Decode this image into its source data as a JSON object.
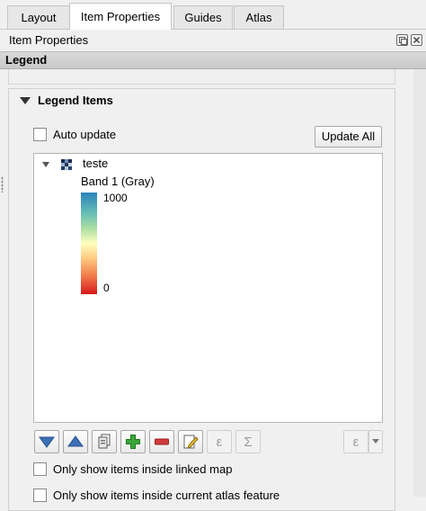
{
  "tabs": [
    {
      "label": "Layout",
      "active": false
    },
    {
      "label": "Item Properties",
      "active": true
    },
    {
      "label": "Guides",
      "active": false
    },
    {
      "label": "Atlas",
      "active": false
    }
  ],
  "panel": {
    "title": "Item Properties",
    "icons": [
      "float-panel-icon",
      "close-panel-icon"
    ]
  },
  "group_header": "Legend",
  "legend_items": {
    "title": "Legend Items",
    "auto_update_label": "Auto update",
    "auto_update_checked": false,
    "update_all_label": "Update All",
    "tree": {
      "layer_name": "teste",
      "band_label": "Band 1 (Gray)",
      "ramp_max": "1000",
      "ramp_min": "0",
      "ramp_colors": [
        "#2b83ba",
        "#abdda4",
        "#ffffbf",
        "#fdae61",
        "#d7191c"
      ]
    },
    "toolbar_icons": [
      "move-down-icon",
      "move-up-icon",
      "add-group-icon",
      "add-item-icon",
      "remove-item-icon",
      "edit-item-icon",
      "expression-icon",
      "sum-icon",
      "filter-expression-icon"
    ],
    "epsilon_glyph": "ε",
    "sigma_glyph": "Σ",
    "only_linked_map_label": "Only show items inside linked map",
    "only_atlas_label": "Only show items inside current atlas feature"
  },
  "colors": {
    "accent_blue": "#3c70b4",
    "add_green": "#3aa53a",
    "remove_red": "#d23c3c",
    "panel_bg": "#f0f0f0"
  }
}
